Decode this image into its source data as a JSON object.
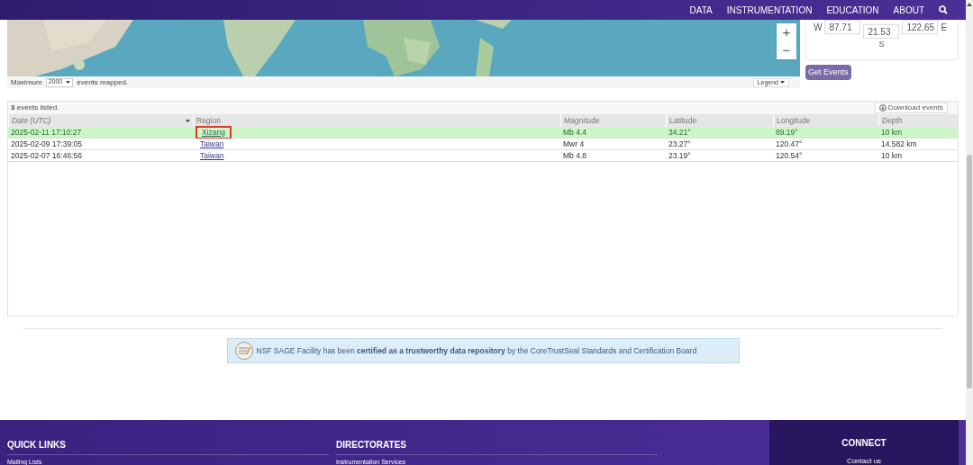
{
  "nav": {
    "items": [
      "DATA",
      "INSTRUMENTATION",
      "EDUCATION",
      "ABOUT"
    ]
  },
  "map": {
    "zoom_in": "+",
    "zoom_out": "−",
    "legend": "Legend"
  },
  "max_events": {
    "prefix": "Maximum",
    "value": "2000",
    "suffix": "events mapped."
  },
  "bounds": {
    "west_label": "W",
    "west": "87.71",
    "south": "21.53",
    "east": "122.65",
    "east_label": "E",
    "south_label": "S",
    "button": "Get Events"
  },
  "events": {
    "count": "3",
    "count_text": "events listed.",
    "download": "Download events",
    "columns": [
      "Date (UTC)",
      "Region",
      "Magnitude",
      "Latitude",
      "Longitude",
      "Depth"
    ],
    "rows": [
      {
        "selected": true,
        "cells": [
          "2025-02-11 17:10:27",
          "Xizang",
          "Mb 4.4",
          "34.21°",
          "89.19°",
          "10 km"
        ]
      },
      {
        "selected": false,
        "cells": [
          "2025-02-09 17:39:05",
          "Taiwan",
          "Mwr 4",
          "23.27°",
          "120.47°",
          "14.582 km"
        ]
      },
      {
        "selected": false,
        "cells": [
          "2025-02-07 16:46:56",
          "Taiwan",
          "Mb 4.8",
          "23.19°",
          "120.54°",
          "10 km"
        ]
      }
    ]
  },
  "banner": {
    "text": "NSF SAGE Facility has been **certified as a trustworthy data repository** by the CoreTrustSeal Standards and Certification Board"
  },
  "footer": {
    "columns": [
      {
        "title": "QUICK LINKS",
        "link": "Mailing Lists"
      },
      {
        "title": "DIRECTORATES",
        "link": "Instrumentation Services"
      }
    ],
    "connect": {
      "title": "CONNECT",
      "link": "Contact us"
    }
  }
}
